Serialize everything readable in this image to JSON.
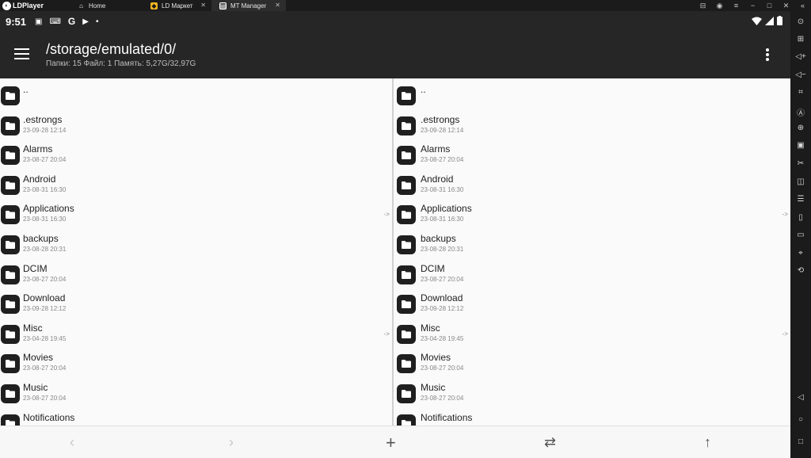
{
  "window": {
    "brand": "LDPlayer",
    "tabs": [
      {
        "label": "Home"
      },
      {
        "label": "LD Маркет"
      },
      {
        "label": "MT Manager"
      }
    ]
  },
  "status_bar": {
    "time": "9:51"
  },
  "app_bar": {
    "path": "/storage/emulated/0/",
    "summary": "Папки: 15  Файл: 1  Память: 5,27G/32,97G"
  },
  "left_pane": {
    "items": [
      {
        "name": "..",
        "date": ""
      },
      {
        "name": ".estrongs",
        "date": "23-09-28 12:14"
      },
      {
        "name": "Alarms",
        "date": "23-08-27 20:04"
      },
      {
        "name": "Android",
        "date": "23-08-31 16:30"
      },
      {
        "name": "Applications",
        "date": "23-08-31 16:30",
        "link": "->"
      },
      {
        "name": "backups",
        "date": "23-08-28 20:31"
      },
      {
        "name": "DCIM",
        "date": "23-08-27 20:04"
      },
      {
        "name": "Download",
        "date": "23-09-28 12:12"
      },
      {
        "name": "Misc",
        "date": "23-04-28 19:45",
        "link": "->"
      },
      {
        "name": "Movies",
        "date": "23-08-27 20:04"
      },
      {
        "name": "Music",
        "date": "23-08-27 20:04"
      },
      {
        "name": "Notifications",
        "date": ""
      }
    ]
  },
  "right_pane": {
    "items": [
      {
        "name": "..",
        "date": ""
      },
      {
        "name": ".estrongs",
        "date": "23-09-28 12:14"
      },
      {
        "name": "Alarms",
        "date": "23-08-27 20:04"
      },
      {
        "name": "Android",
        "date": "23-08-31 16:30"
      },
      {
        "name": "Applications",
        "date": "23-08-31 16:30",
        "link": "->"
      },
      {
        "name": "backups",
        "date": "23-08-28 20:31"
      },
      {
        "name": "DCIM",
        "date": "23-08-27 20:04"
      },
      {
        "name": "Download",
        "date": "23-09-28 12:12"
      },
      {
        "name": "Misc",
        "date": "23-04-28 19:45",
        "link": "->"
      },
      {
        "name": "Movies",
        "date": "23-08-27 20:04"
      },
      {
        "name": "Music",
        "date": "23-08-27 20:04"
      },
      {
        "name": "Notifications",
        "date": ""
      }
    ]
  },
  "bottom_bar": {
    "back_icon": "chevron-left-icon",
    "forward_icon": "chevron-right-icon",
    "add_icon": "plus-icon",
    "swap_icon": "swap-icon",
    "up_icon": "arrow-up-icon"
  },
  "colors": {
    "toolbar_bg": "#262626",
    "pane_bg": "#fafafa",
    "folder_icon_bg": "#1f1f1f",
    "emulator_chrome": "#1b1b1b"
  }
}
